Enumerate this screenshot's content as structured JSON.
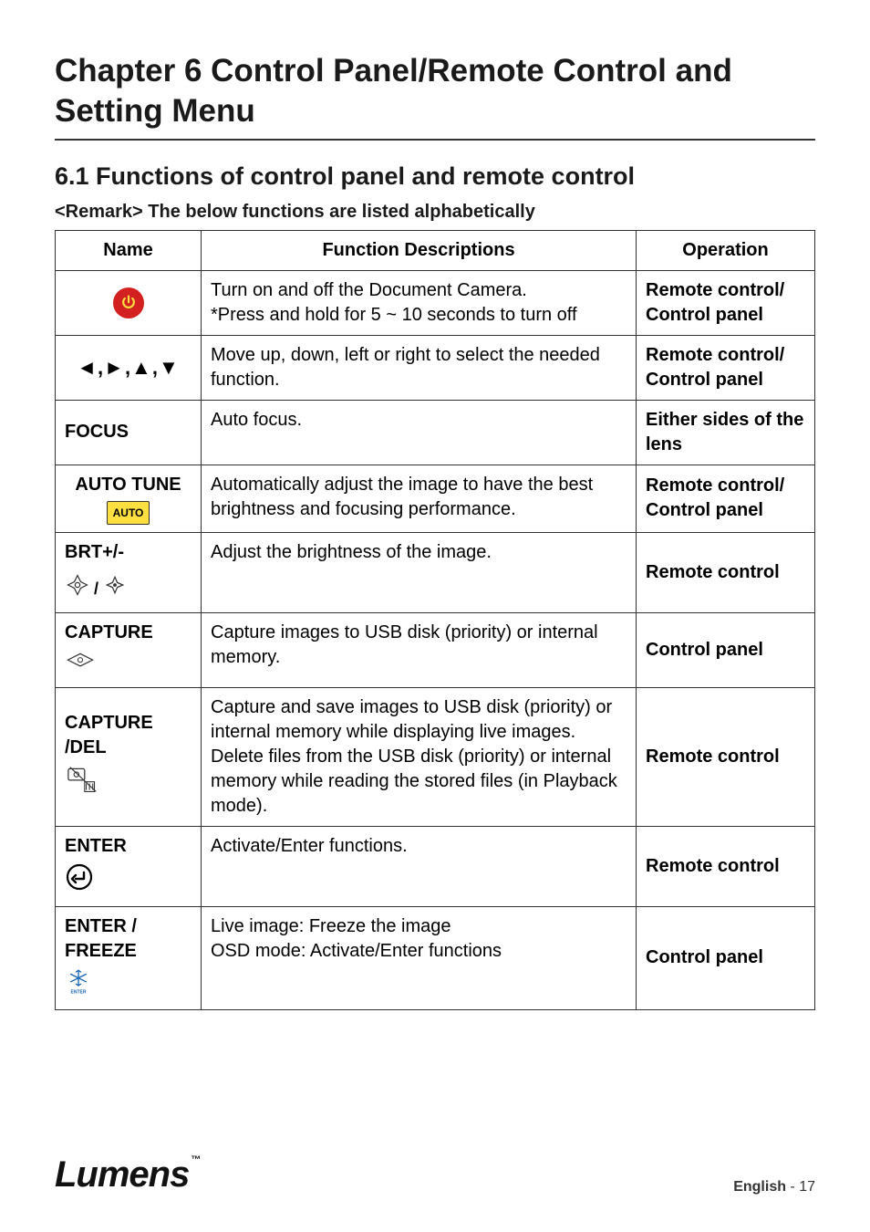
{
  "chapter_title": "Chapter 6 Control Panel/Remote Control and Setting Menu",
  "section_title": "6.1 Functions of control panel and remote control",
  "remark": "<Remark> The below functions are listed alphabetically",
  "table": {
    "headers": {
      "name": "Name",
      "desc": "Function Descriptions",
      "op": "Operation"
    },
    "rows": [
      {
        "name_text": "",
        "icon": "power",
        "desc": "Turn on and off the Document Camera.\n*Press and hold for 5 ~ 10 seconds to turn off",
        "op": "Remote control/ Control panel"
      },
      {
        "name_text": "",
        "icon": "arrows",
        "desc": "Move up, down, left or right to select the needed function.",
        "op": "Remote control/ Control panel"
      },
      {
        "name_text": "FOCUS",
        "icon": "",
        "desc": "Auto focus.",
        "op": "Either sides of the lens"
      },
      {
        "name_text": "AUTO TUNE",
        "icon": "auto",
        "desc": "Automatically adjust the image to have the best brightness and focusing performance.",
        "op": "Remote control/ Control panel"
      },
      {
        "name_text": "BRT+/-",
        "icon": "brt",
        "desc": "Adjust the brightness of the image.",
        "op": "Remote control"
      },
      {
        "name_text": "CAPTURE",
        "icon": "capture",
        "desc": "Capture images to USB disk (priority) or internal memory.",
        "op": "Control panel"
      },
      {
        "name_text": "CAPTURE /DEL",
        "icon": "capdel",
        "desc": "Capture and save images to USB disk (priority) or internal memory while displaying live images.\nDelete files from the USB disk (priority) or internal memory while reading the stored files (in Playback mode).",
        "op": "Remote control"
      },
      {
        "name_text": "ENTER",
        "icon": "enter",
        "desc": "Activate/Enter functions.",
        "op": "Remote control"
      },
      {
        "name_text": "ENTER / FREEZE",
        "icon": "freeze",
        "desc": "Live image: Freeze the image\nOSD mode: Activate/Enter functions",
        "op": "Control panel"
      }
    ]
  },
  "footer": {
    "logo": "Lumens",
    "tm": "™",
    "lang": "English",
    "sep": " -  ",
    "page": "17"
  },
  "icons": {
    "arrows_glyphs": "◄,►,▲,▼",
    "auto_label": "AUTO",
    "brt_sep": "/",
    "freeze_label": "ENTER"
  }
}
